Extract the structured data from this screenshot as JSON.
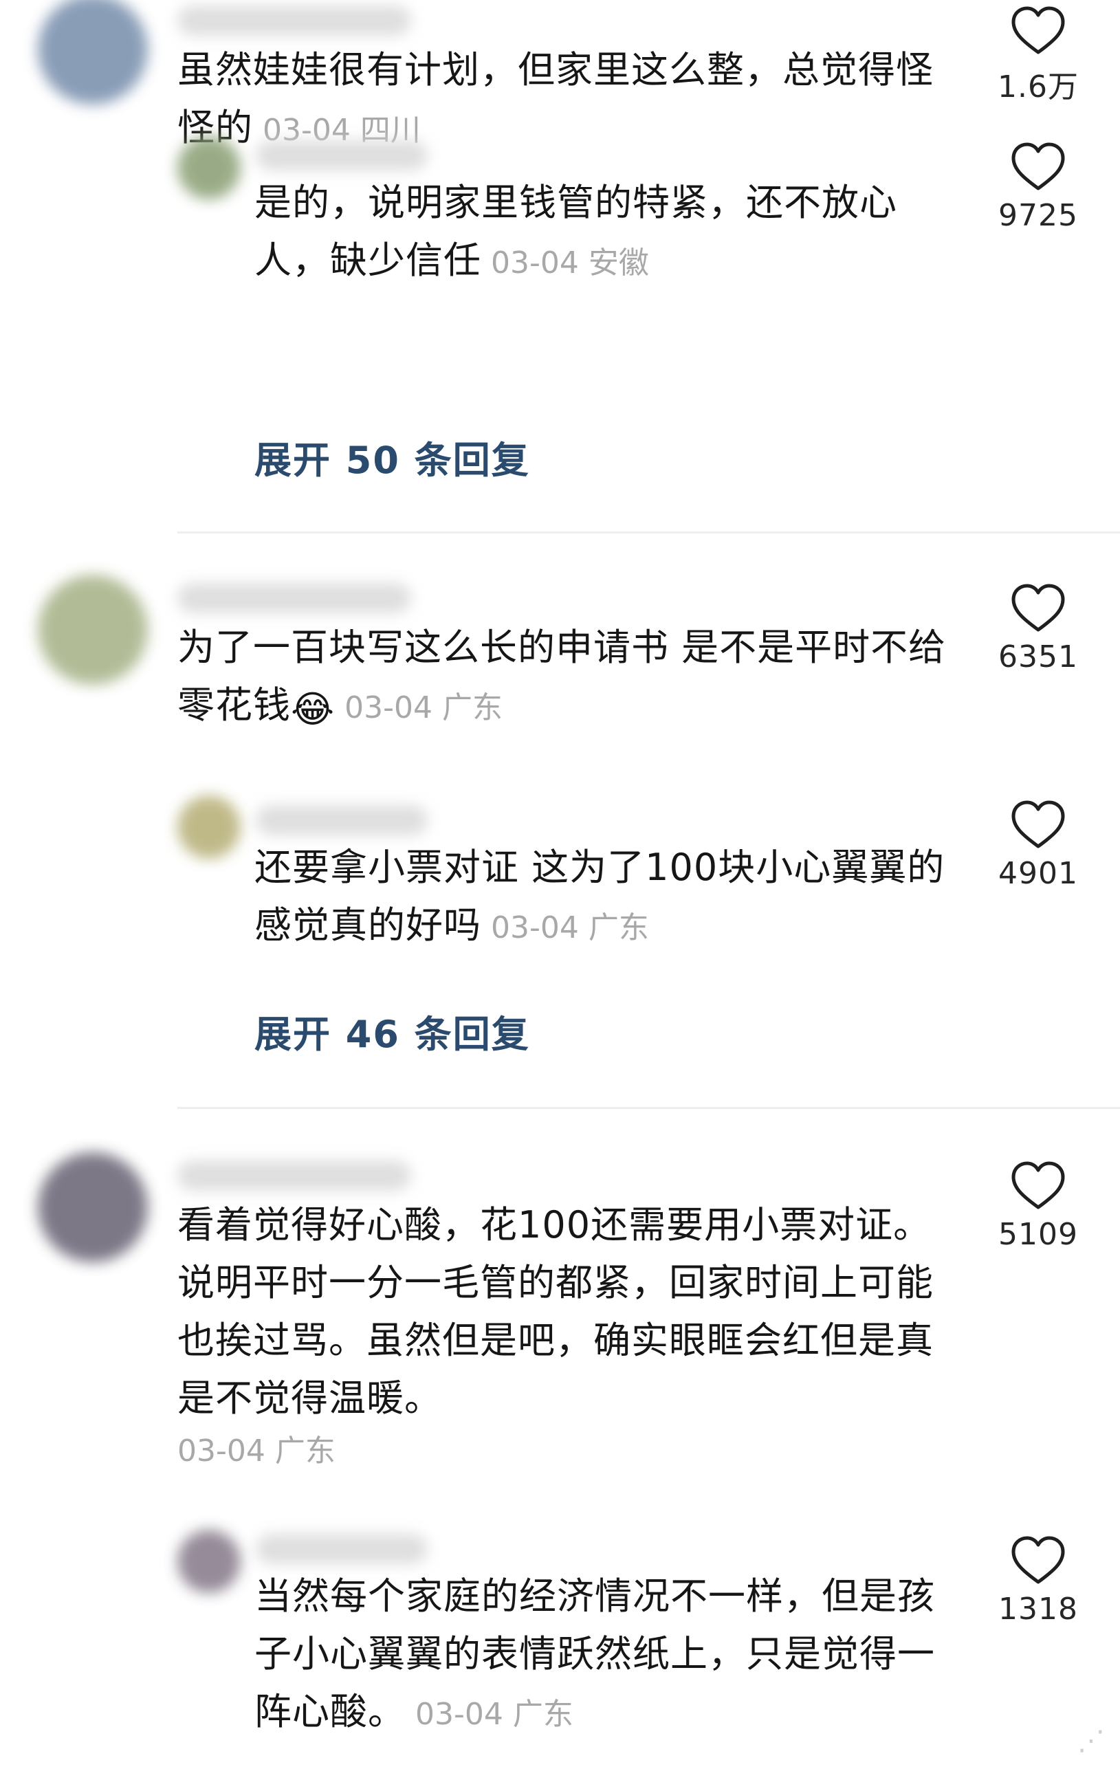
{
  "threads": [
    {
      "comment": {
        "text": "虽然娃娃很有计划，但家里这么整，总觉得怪怪的",
        "meta": "03-04 四川",
        "likes": "1.6万",
        "avatar_color": "#7d93b0"
      },
      "reply": {
        "text": "是的，说明家里钱管的特紧，还不放心人，缺少信任",
        "meta": "03-04 安徽",
        "likes": "9725",
        "avatar_color": "#8fa37a"
      },
      "expand_label": "展开 50 条回复"
    },
    {
      "comment": {
        "text": "为了一百块写这么长的申请书 是不是平时不给零花钱",
        "emoji": "😂",
        "meta": "03-04 广东",
        "likes": "6351",
        "avatar_color": "#a9b58c"
      },
      "reply": {
        "text": "还要拿小票对证 这为了100块小心翼翼的感觉真的好吗",
        "meta": "03-04 广东",
        "likes": "4901",
        "avatar_color": "#b9b27c"
      },
      "expand_label": "展开 46 条回复"
    },
    {
      "comment": {
        "text": "看着觉得好心酸，花100还需要用小票对证。说明平时一分一毛管的都紧，回家时间上可能也挨过骂。虽然但是吧，确实眼眶会红但是真是不觉得温暖。",
        "meta": "03-04 广东",
        "likes": "5109",
        "avatar_color": "#6f6a7a"
      },
      "reply": {
        "text": "当然每个家庭的经济情况不一样，但是孩子小心翼翼的表情跃然纸上，只是觉得一阵心酸。",
        "meta": "03-04 广东",
        "likes": "1318",
        "avatar_color": "#8a7f8e"
      }
    }
  ],
  "colors": {
    "text": "#161616",
    "meta": "#a8a8a8",
    "expand": "#2a4a6e",
    "divider": "#eeeeee"
  },
  "icons": {
    "like": "heart-outline-icon",
    "corner": "dots-icon"
  }
}
